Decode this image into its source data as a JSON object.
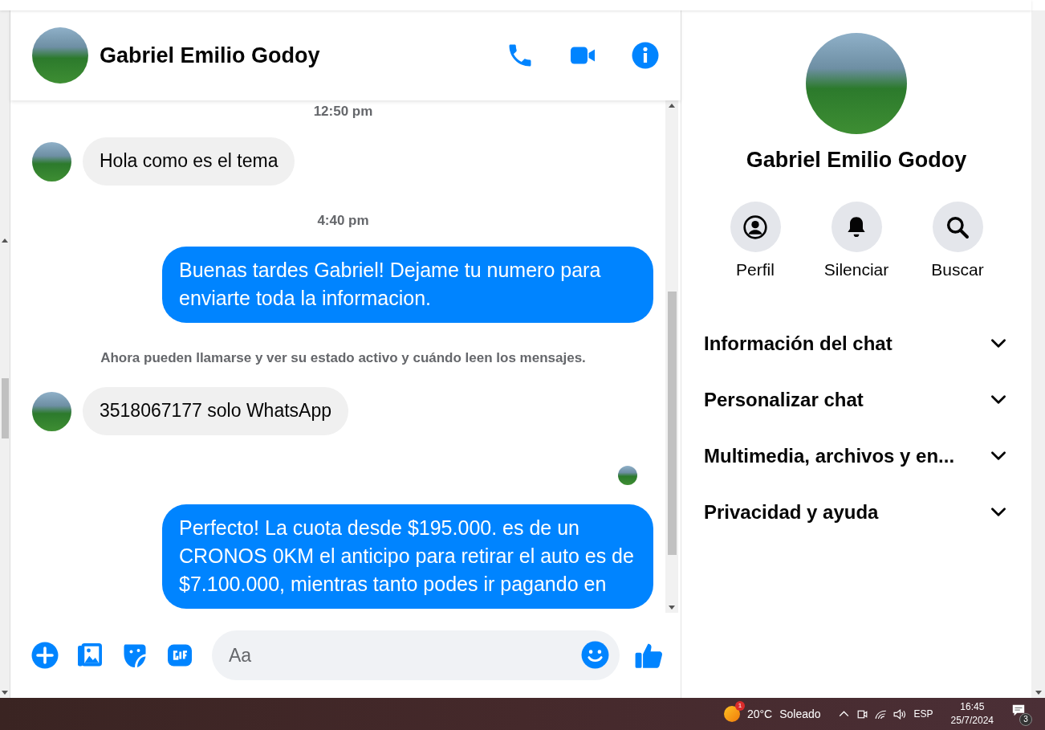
{
  "header": {
    "name": "Gabriel Emilio Godoy"
  },
  "messages": [
    {
      "kind": "time",
      "text": "12:50 pm"
    },
    {
      "kind": "incoming",
      "text": "Hola como es el tema"
    },
    {
      "kind": "time",
      "text": "4:40 pm"
    },
    {
      "kind": "outgoing",
      "text": "Buenas tardes Gabriel! Dejame tu numero para enviarte toda la informacion."
    },
    {
      "kind": "notice",
      "text": "Ahora pueden llamarse y ver su estado activo y cuándo leen los mensajes."
    },
    {
      "kind": "incoming",
      "text": "3518067177 solo WhatsApp"
    },
    {
      "kind": "seen"
    },
    {
      "kind": "outgoing",
      "text": "Perfecto! La cuota desde $195.000. es de un CRONOS 0KM el anticipo para retirar el auto es de $7.100.000, mientras tanto podes ir pagando en"
    }
  ],
  "composer": {
    "placeholder": "Aa"
  },
  "profile": {
    "name": "Gabriel Emilio Godoy",
    "actions": [
      {
        "kind": "profile",
        "label": "Perfil"
      },
      {
        "kind": "mute",
        "label": "Silenciar"
      },
      {
        "kind": "search",
        "label": "Buscar"
      }
    ],
    "sections": [
      {
        "title": "Información del chat",
        "expanded": false
      },
      {
        "title": "Personalizar chat",
        "expanded": false
      },
      {
        "title": "Multimedia, archivos y en...",
        "expanded": false
      },
      {
        "title": "Privacidad y ayuda",
        "expanded": false
      }
    ]
  },
  "taskbar": {
    "weather": {
      "badge": "1",
      "temp": "20°C",
      "condition": "Soleado"
    },
    "language": "ESP",
    "time": "16:45",
    "date": "25/7/2024",
    "notifications": "3"
  }
}
